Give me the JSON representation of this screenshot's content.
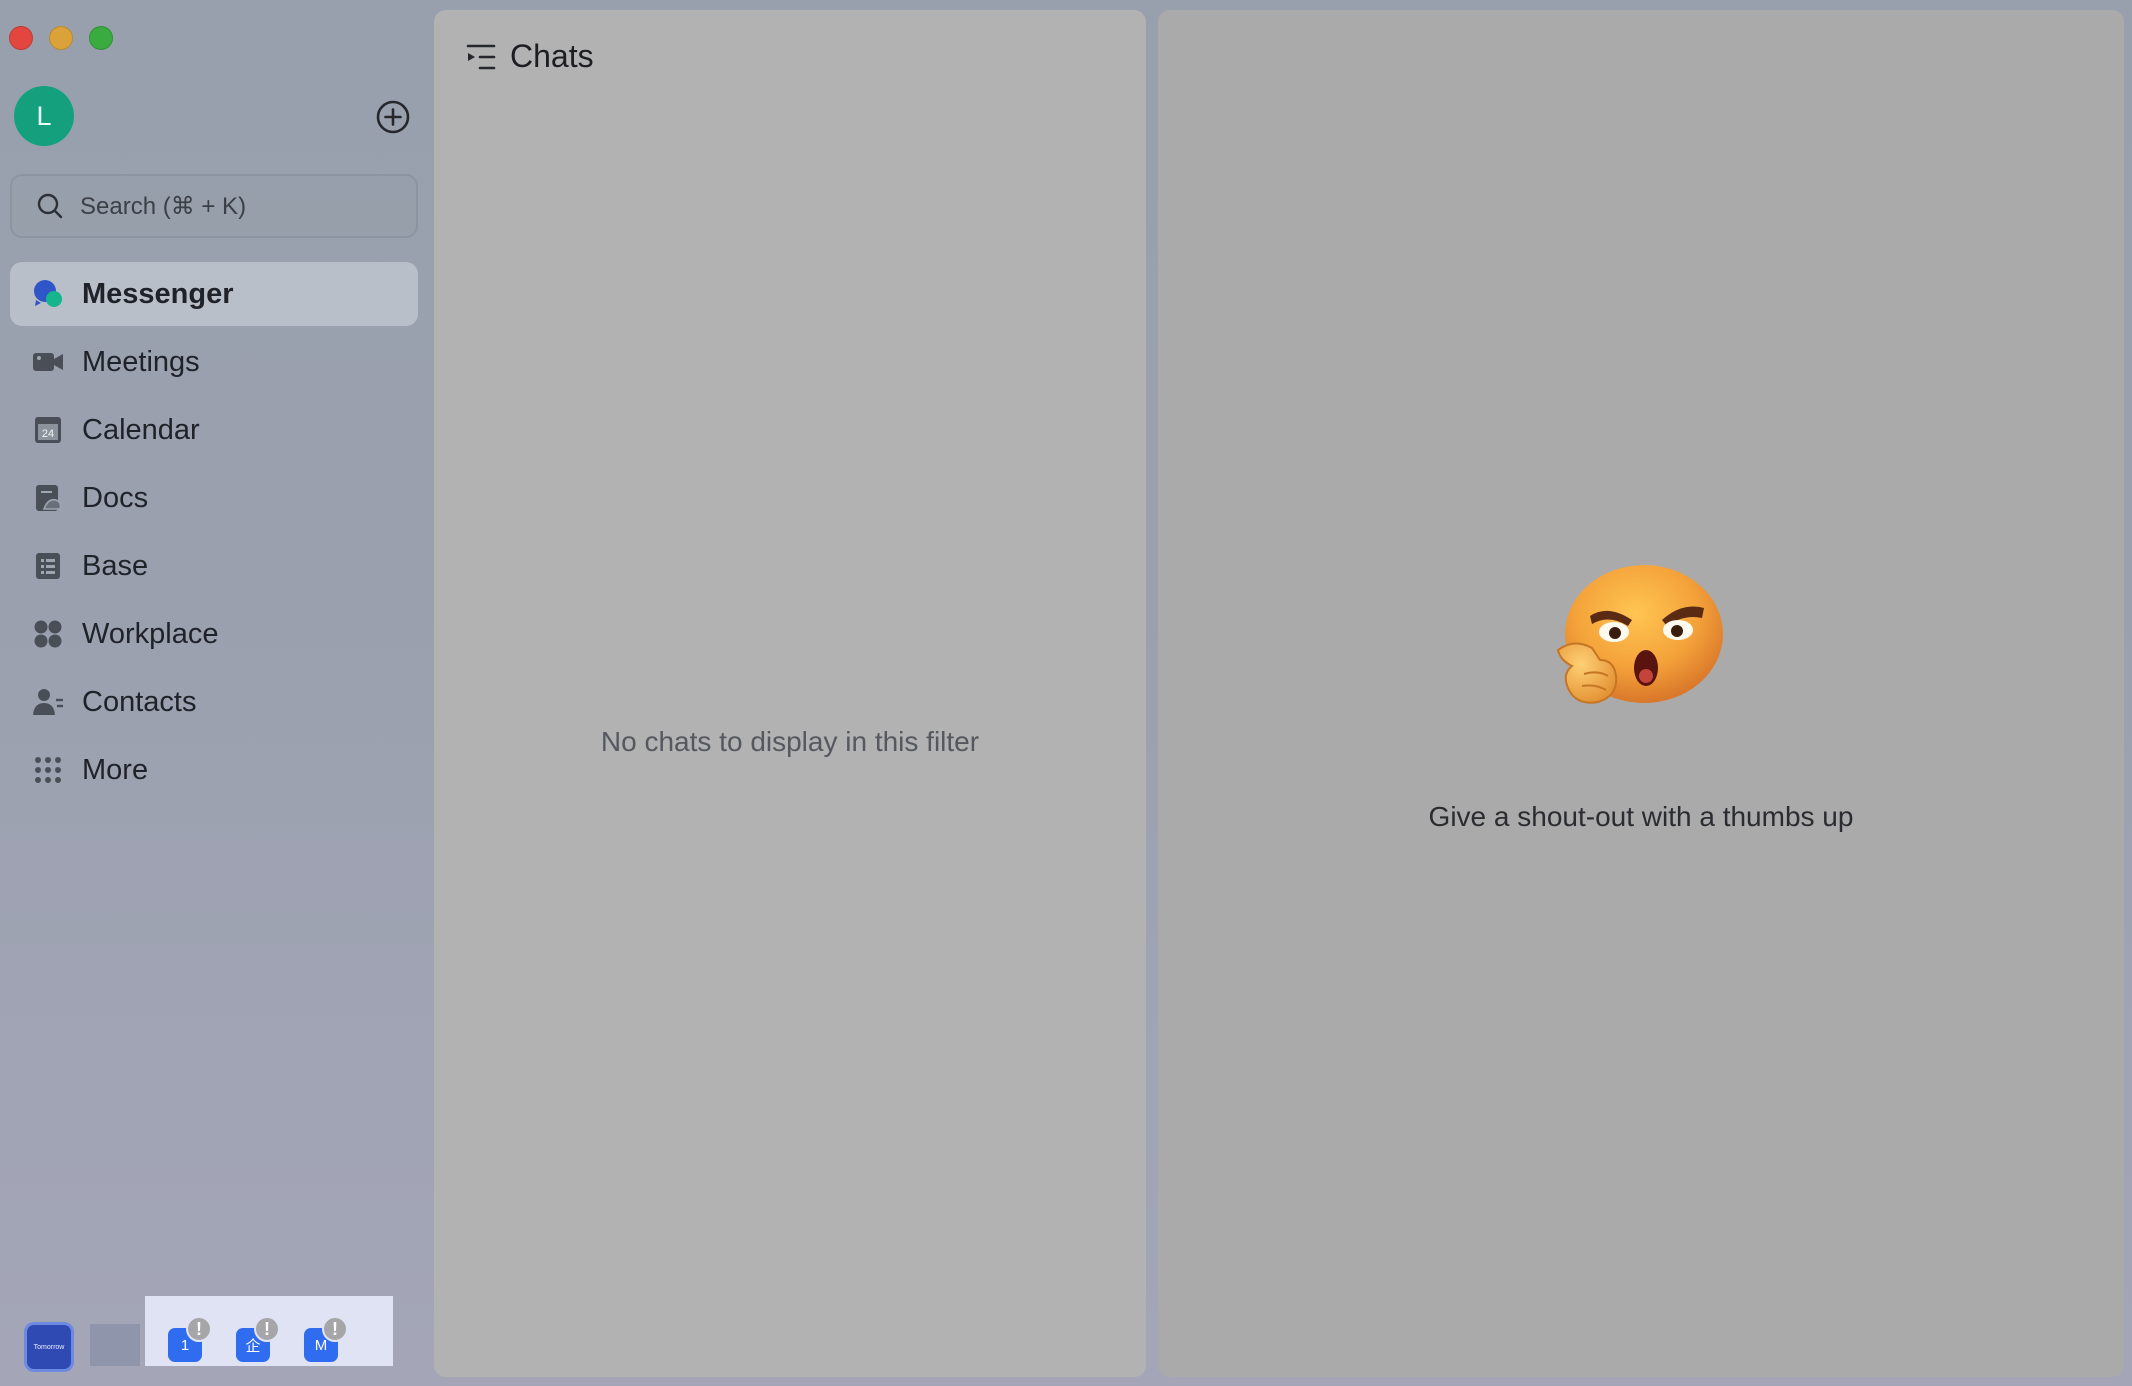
{
  "window": {
    "controls": [
      "close",
      "minimize",
      "maximize"
    ]
  },
  "sidebar": {
    "avatar_initial": "L",
    "add_icon": "plus-circle-icon",
    "search": {
      "placeholder": "Search (⌘ + K)",
      "icon": "search-icon"
    },
    "items": [
      {
        "label": "Messenger",
        "icon": "messenger-icon",
        "active": true
      },
      {
        "label": "Meetings",
        "icon": "video-camera-icon",
        "active": false
      },
      {
        "label": "Calendar",
        "icon": "calendar-icon",
        "active": false
      },
      {
        "label": "Docs",
        "icon": "docs-icon",
        "active": false
      },
      {
        "label": "Base",
        "icon": "base-icon",
        "active": false
      },
      {
        "label": "Workplace",
        "icon": "workplace-icon",
        "active": false
      },
      {
        "label": "Contacts",
        "icon": "contacts-icon",
        "active": false
      },
      {
        "label": "More",
        "icon": "more-grid-icon",
        "active": false
      }
    ]
  },
  "dock": {
    "thumbnail_label": "Tomorrow",
    "apps": [
      {
        "glyph": "1",
        "badge": "!"
      },
      {
        "glyph": "企",
        "badge": "!"
      },
      {
        "glyph": "M",
        "badge": "!"
      }
    ]
  },
  "chats": {
    "title": "Chats",
    "empty_message": "No chats to display in this filter"
  },
  "detail": {
    "emoji": "thumbs-up-emoji",
    "caption": "Give a shout-out with a thumbs up"
  },
  "colors": {
    "avatar": "#14a07d",
    "active_nav": "#bec4cd",
    "accent_blue": "#2f6cf0",
    "close": "#e2463f",
    "minimize": "#dca23a",
    "maximize": "#3aab3f"
  }
}
